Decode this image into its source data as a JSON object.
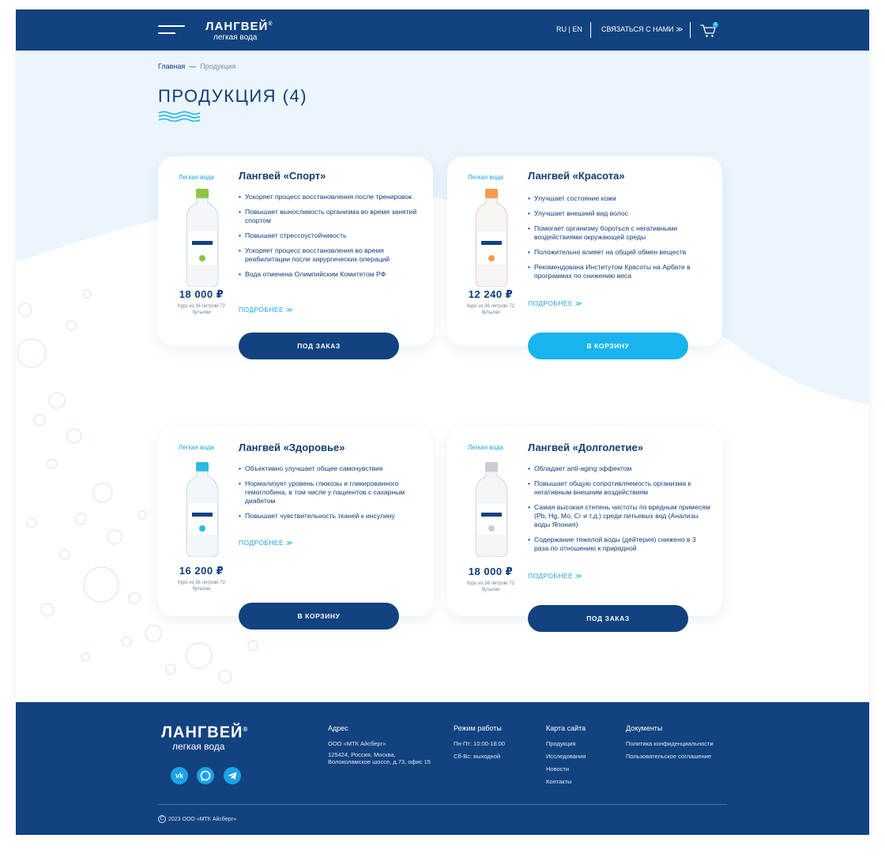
{
  "header": {
    "logo_main": "ЛАНГВЕЙ",
    "logo_reg": "®",
    "logo_sub": "легкая вода",
    "lang_ru": "RU",
    "lang_sep": "|",
    "lang_en": "EN",
    "contact": "СВЯЗАТЬСЯ С НАМИ ≫",
    "cart_count": "0"
  },
  "breadcrumb": {
    "home": "Главная",
    "dash": "—",
    "current": "Продукция"
  },
  "page_title": "ПРОДУКЦИЯ (4)",
  "colors": {
    "navy": "#12427f",
    "accent": "#18b4ee",
    "background": "#eaf5fd"
  },
  "products": [
    {
      "brand": "Легкая вода",
      "title": "Лангвей «Спорт»",
      "cap_color": "#8cc63f",
      "price": "18 000 ₽",
      "note": "Курс из 36 литров/ 72 бутылки",
      "features": [
        "Ускоряет процесс восстановления после тренировок",
        "Повышает выносливость организма во время занятий спортом",
        "Повышает стрессоустойчивость",
        "Ускоряет процесс восстановления во время реабилитации после хирургических операций",
        "Вода отмечена Олимпийским Комитетом РФ"
      ],
      "more": "ПОДРОБНЕЕ ≫",
      "button": "ПОД ЗАКАЗ"
    },
    {
      "brand": "Легкая вода",
      "title": "Лангвей «Красота»",
      "cap_color": "#f59a4b",
      "price": "12 240 ₽",
      "note": "Курс из 36 литров/ 72 бутылки",
      "features": [
        "Улучшает состояние кожи",
        "Улучшает внешний вид волос",
        "Помогает организму бороться с негативными воздействиями окружающей среды",
        "Положительно влияет на общий обмен веществ",
        "Рекомендована Институтом Красоты на Арбате в программах по снижению веса"
      ],
      "more": "ПОДРОБНЕЕ ≫",
      "button": "В КОРЗИНУ"
    },
    {
      "brand": "Легкая вода",
      "title": "Лангвей «Здоровье»",
      "cap_color": "#2bbbe0",
      "price": "16 200 ₽",
      "note": "Курс из 36 литров/ 72 бутылки",
      "features": [
        "Объективно улучшает общее самочувствие",
        "Нормализует уровень глюкозы и гликированного гемоглобина, в том числе у пациентов с сахарным диабетом",
        "Повышает чувствительность тканей к инсулину"
      ],
      "more": "ПОДРОБНЕЕ ≫",
      "button": "В КОРЗИНУ"
    },
    {
      "brand": "Легкая вода",
      "title": "Лангвей «Долголетие»",
      "cap_color": "#c9ccd1",
      "price": "18 000 ₽",
      "note": "Курс из 36 литров/ 72 бутылки",
      "features": [
        "Обладает anti-aging эффектом",
        "Повышает общую сопротивляемость организма к негативным внешним воздействиям",
        "Самая высокая степень чистоты по вредным примесям (Pb, Hg, Mo, Cr и т.д.) среди питьевых вод (Анализы воды Япония)",
        "Содержание тяжелой воды (дейтерия) снижено в 3 раза по отношению к природной"
      ],
      "more": "ПОДРОБНЕЕ ≫",
      "button": "ПОД ЗАКАЗ"
    }
  ],
  "footer": {
    "logo_main": "ЛАНГВЕЙ",
    "logo_reg": "®",
    "logo_sub": "легкая вода",
    "social": {
      "vk": "vk",
      "whatsapp": "whatsapp",
      "telegram": "telegram"
    },
    "address_heading": "Адрес",
    "address_company": "ООО «МТК Айсберг»",
    "address_text": "125424, Россия, Москва, Волоколамское шоссе, д.73, офис 15",
    "hours_heading": "Режим работы",
    "hours_weekdays": "Пн-Пт: 10:00-18:00",
    "hours_weekend": "Сб-Вс: выходной",
    "sitemap_heading": "Карта сайта",
    "sitemap": [
      "Продукция",
      "Исследования",
      "Новости",
      "Контакты"
    ],
    "docs_heading": "Документы",
    "docs": [
      "Политика конфиденциальности",
      "Пользовательское соглашение"
    ],
    "copyright_symbol": "C",
    "copyright": "2023 ООО «МТК Айсберг»"
  }
}
